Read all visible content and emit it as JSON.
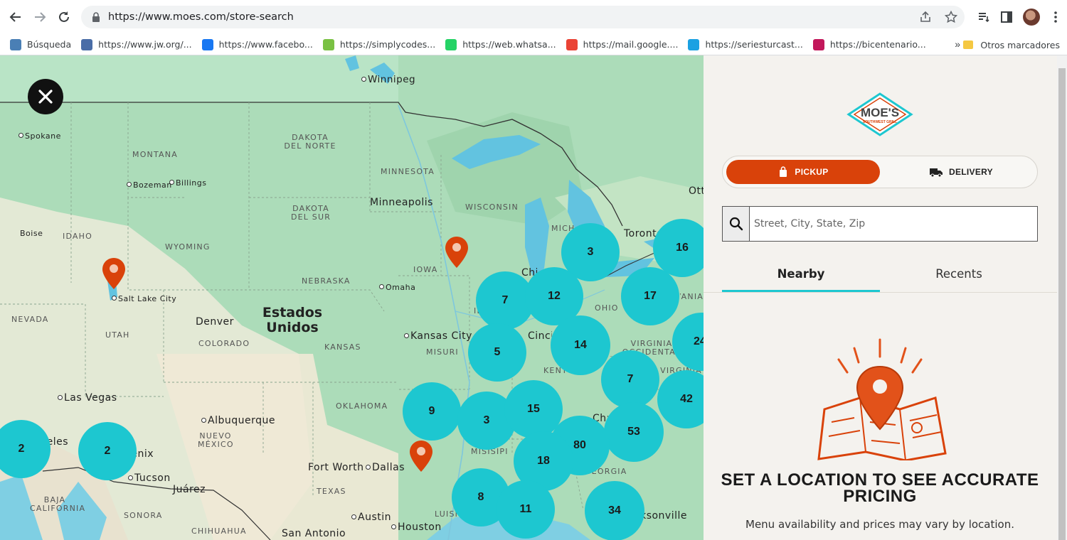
{
  "browser": {
    "url": "https://www.moes.com/store-search",
    "bookmarks": [
      {
        "label": "Búsqueda",
        "icon": "search-lens-icon",
        "color": "#4a7fb5"
      },
      {
        "label": "https://www.jw.org/...",
        "icon": "jw-icon",
        "color": "#4a6da7"
      },
      {
        "label": "https://www.facebo...",
        "icon": "facebook-icon",
        "color": "#1877f2"
      },
      {
        "label": "https://simplycodes...",
        "icon": "simplycodes-icon",
        "color": "#7ac143"
      },
      {
        "label": "https://web.whatsa...",
        "icon": "whatsapp-icon",
        "color": "#25d366"
      },
      {
        "label": "https://mail.google....",
        "icon": "gmail-icon",
        "color": "#ea4335"
      },
      {
        "label": "https://seriesturcast...",
        "icon": "play-icon",
        "color": "#1ba1e2"
      },
      {
        "label": "https://bicentenario...",
        "icon": "bicentenario-icon",
        "color": "#c2185b"
      }
    ],
    "more_bookmarks": "»",
    "other_bookmarks": "Otros marcadores"
  },
  "map": {
    "country_label": "Estados Unidos",
    "state_labels": [
      "DAKOTA DEL NORTE",
      "MONTANA",
      "MINNESOTA",
      "DAKOTA DEL SUR",
      "WISCONSIN",
      "IDAHO",
      "WYOMING",
      "IOWA",
      "NEBRASKA",
      "NEVADA",
      "UTAH",
      "COLORADO",
      "KANSAS",
      "MISURI",
      "OHIO",
      "KENTUCKY",
      "VIRGINIA OCCIDENTAL",
      "OKLAHOMA",
      "NUEVO MÉXICO",
      "TEXAS",
      "MISISIPI",
      "BAJA CALIFORNIA",
      "SONORA",
      "CHIHUAHUA",
      "GEORGIA",
      "LUISIANA",
      "MÍCHIGAN",
      "ILLINOIS",
      "PENSILVANIA",
      "VIRGINIA"
    ],
    "city_labels": [
      "Winnipeg",
      "Spokane",
      "Bozeman",
      "Billings",
      "Minneapolis",
      "Boise",
      "Salt Lake City",
      "Omaha",
      "Denver",
      "Kansas City",
      "Las Vegas",
      "Albuquerque",
      "Fort Worth",
      "Dallas",
      "Tucson",
      "Juárez",
      "Austin",
      "Houston",
      "San Antonio",
      "Toronto",
      "Chicago",
      "Cincinnati",
      "Charlotte",
      "Jacksonville",
      "Phoenix",
      "Los Ángeles",
      "Ottawa"
    ],
    "clusters": [
      3,
      16,
      7,
      12,
      17,
      5,
      14,
      24,
      7,
      42,
      9,
      3,
      15,
      53,
      80,
      18,
      2,
      2,
      8,
      11,
      34
    ],
    "pins": 3
  },
  "panel": {
    "brand": "MOE'S",
    "brand_sub": "SOUTHWEST GRILL",
    "pickup_label": "PICKUP",
    "delivery_label": "DELIVERY",
    "search_placeholder": "Street, City, State, Zip",
    "tabs": [
      "Nearby",
      "Recents"
    ],
    "empty_title": "SET A LOCATION TO SEE ACCURATE PRICING",
    "empty_subtitle": "Menu availability and prices may vary by location.",
    "accent_color": "#1dc7d0",
    "brand_color": "#d9420a"
  }
}
